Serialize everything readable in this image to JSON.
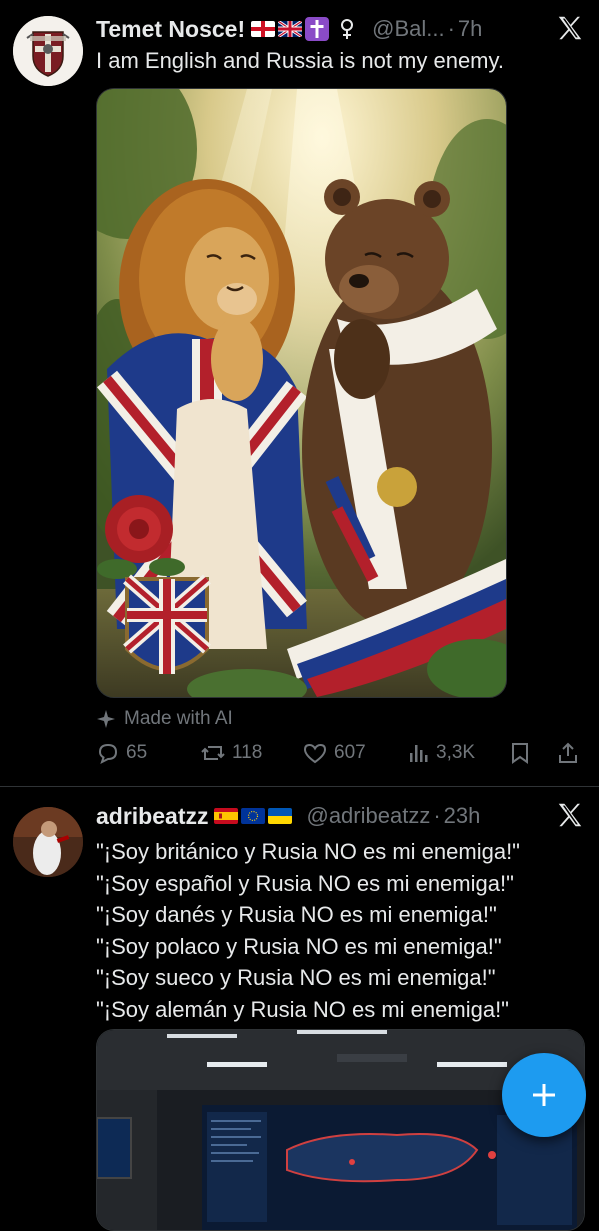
{
  "tweets": [
    {
      "author": {
        "name": "Temet Nosce!",
        "handle": "@Bal...",
        "time": "7h",
        "flags": [
          "england",
          "uk"
        ],
        "emoji": [
          "latin-cross",
          "female-sign"
        ]
      },
      "text": "I am English and Russia is not my enemy.",
      "media_label": "Made with AI",
      "stats": {
        "replies": "65",
        "reposts": "118",
        "likes": "607",
        "views": "3,3K"
      }
    },
    {
      "author": {
        "name": "adribeatzz",
        "handle": "@adribeatzz",
        "time": "23h",
        "flags": [
          "spain",
          "eu",
          "ukraine"
        ]
      },
      "lines": [
        "\"¡Soy británico y Rusia NO es mi enemiga!\"",
        "\"¡Soy español y Rusia NO es mi enemiga!\"",
        "\"¡Soy danés y Rusia NO es mi enemiga!\"",
        "\"¡Soy polaco y Rusia NO es mi enemiga!\"",
        "\"¡Soy sueco y Rusia NO es mi enemiga!\"",
        "\"¡Soy alemán y Rusia NO es mi enemiga!\""
      ]
    }
  ],
  "colors": {
    "background": "#000000",
    "text": "#e7e9ea",
    "muted": "#71767b",
    "accent": "#1d9bf0",
    "divider": "#2f3336"
  },
  "icons": [
    "x-logo-icon",
    "sparkle-icon",
    "reply-icon",
    "repost-icon",
    "like-icon",
    "views-icon",
    "bookmark-icon",
    "share-icon",
    "compose-plus-icon"
  ]
}
